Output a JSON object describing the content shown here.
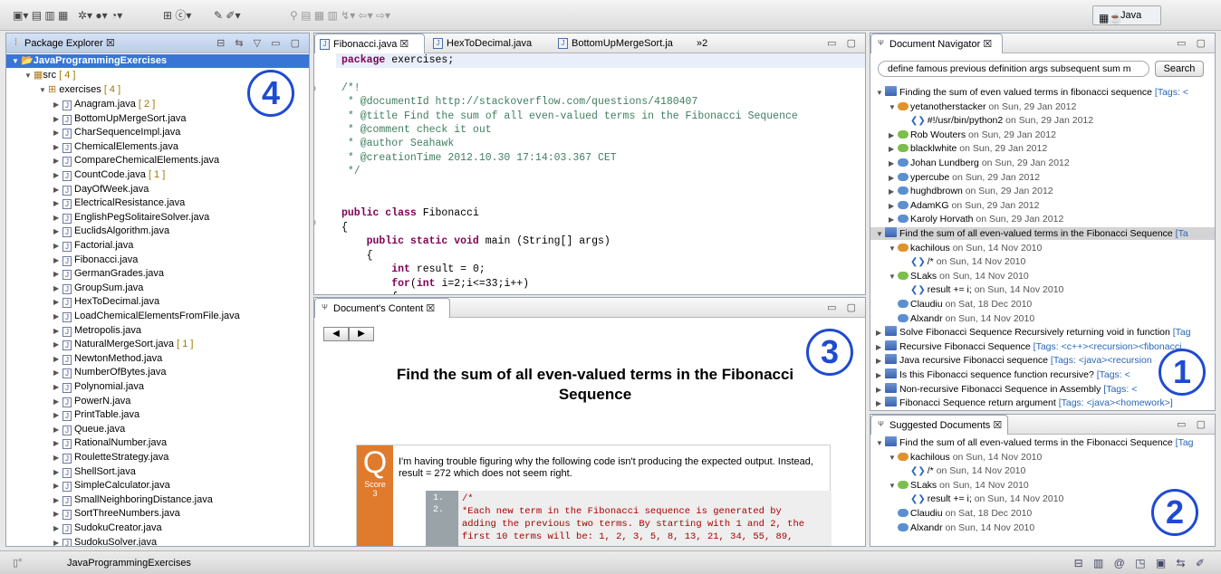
{
  "toolbar": {
    "perspective": "Java"
  },
  "package_explorer": {
    "tab": "Package Explorer",
    "project": "JavaProgrammingExercises",
    "src": "src",
    "src_count": "[ 4 ]",
    "pkg": "exercises",
    "pkg_count": "[ 4 ]",
    "files": [
      [
        "Anagram.java",
        "[ 2 ]"
      ],
      [
        "BottomUpMergeSort.java",
        ""
      ],
      [
        "CharSequenceImpl.java",
        ""
      ],
      [
        "ChemicalElements.java",
        ""
      ],
      [
        "CompareChemicalElements.java",
        ""
      ],
      [
        "CountCode.java",
        "[ 1 ]"
      ],
      [
        "DayOfWeek.java",
        ""
      ],
      [
        "ElectricalResistance.java",
        ""
      ],
      [
        "EnglishPegSolitaireSolver.java",
        ""
      ],
      [
        "EuclidsAlgorithm.java",
        ""
      ],
      [
        "Factorial.java",
        ""
      ],
      [
        "Fibonacci.java",
        ""
      ],
      [
        "GermanGrades.java",
        ""
      ],
      [
        "GroupSum.java",
        ""
      ],
      [
        "HexToDecimal.java",
        ""
      ],
      [
        "LoadChemicalElementsFromFile.java",
        ""
      ],
      [
        "Metropolis.java",
        ""
      ],
      [
        "NaturalMergeSort.java",
        "[ 1 ]"
      ],
      [
        "NewtonMethod.java",
        ""
      ],
      [
        "NumberOfBytes.java",
        ""
      ],
      [
        "Polynomial.java",
        ""
      ],
      [
        "PowerN.java",
        ""
      ],
      [
        "PrintTable.java",
        ""
      ],
      [
        "Queue.java",
        ""
      ],
      [
        "RationalNumber.java",
        ""
      ],
      [
        "RouletteStrategy.java",
        ""
      ],
      [
        "ShellSort.java",
        ""
      ],
      [
        "SimpleCalculator.java",
        ""
      ],
      [
        "SmallNeighboringDistance.java",
        ""
      ],
      [
        "SortThreeNumbers.java",
        ""
      ],
      [
        "SudokuCreator.java",
        ""
      ],
      [
        "SudokuSolver.java",
        ""
      ]
    ]
  },
  "editor": {
    "tabs": [
      "Fibonacci.java",
      "HexToDecimal.java",
      "BottomUpMergeSort.ja"
    ],
    "overflow": "»2"
  },
  "content": {
    "tab": "Document's Content",
    "title": "Find the sum of all even-valued terms in the Fibonacci Sequence",
    "q_letter": "Q",
    "score_label": "Score",
    "score": "3",
    "question": "I'm having trouble figuring why the following code isn't producing the expected output. Instead, result = 272 which does not seem right.",
    "line_nums": [
      "1.",
      "2."
    ],
    "code_l1": "/*",
    "code_l2": " *Each new term in the Fibonacci sequence is generated by",
    "code_l3": "adding the previous two terms. By starting with 1 and 2, the",
    "code_l4": "first 10 terms will be: 1, 2, 3, 5, 8, 13, 21, 34, 55, 89,"
  },
  "navigator": {
    "tab": "Document Navigator",
    "query": "define famous previous definition args subsequent sum m",
    "search": "Search"
  },
  "suggested": {
    "tab": "Suggested Documents"
  },
  "statusbar": {
    "project": "JavaProgrammingExercises"
  },
  "callouts": [
    "4",
    "3",
    "1",
    "2"
  ]
}
